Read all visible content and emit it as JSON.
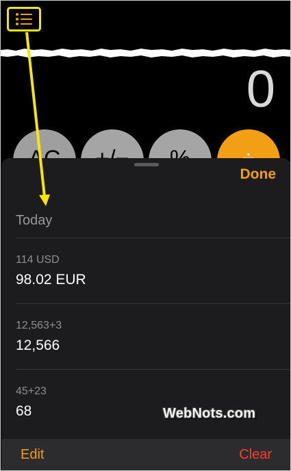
{
  "calculator": {
    "display_value": "0",
    "keys": {
      "ac": "AC",
      "sign": "+/−",
      "percent": "%",
      "operator": "÷"
    }
  },
  "history": {
    "done_label": "Done",
    "section_title": "Today",
    "entries": [
      {
        "expression": "114 USD",
        "result": "98.02 EUR"
      },
      {
        "expression": "12,563+3",
        "result": "12,566"
      },
      {
        "expression": "45+23",
        "result": "68"
      }
    ],
    "edit_label": "Edit",
    "clear_label": "Clear"
  },
  "watermark": "WebNots.com",
  "colors": {
    "accent": "#f29f15",
    "clear": "#ff3b30",
    "annotation": "#f5e60a"
  },
  "icons": {
    "history": "list-bullet-icon"
  }
}
